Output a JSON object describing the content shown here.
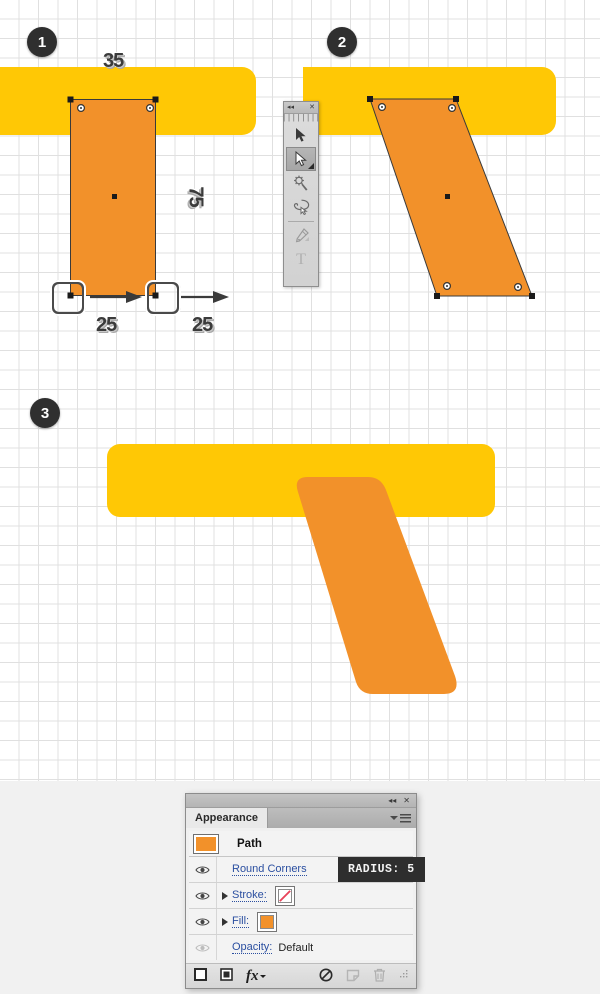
{
  "colors": {
    "yellow": "#ffc805",
    "orange": "#f2912a",
    "badge_bg": "#2f2f2f",
    "tooltip_bg": "#2e2e2e",
    "link_blue": "#2b4fa0",
    "stroke_none_red": "#e8435a"
  },
  "steps": [
    {
      "number": "1"
    },
    {
      "number": "2"
    },
    {
      "number": "3"
    }
  ],
  "dimensions": {
    "width_label": "35",
    "height_label": "75",
    "offset_left_label": "25",
    "offset_right_label": "25"
  },
  "toolbar": {
    "collapse_icon": "◂◂",
    "close_icon": "✕",
    "grip": "||||||||",
    "tools": [
      {
        "name": "selection-tool",
        "glyph": "selection",
        "selected": false
      },
      {
        "name": "direct-selection-tool",
        "glyph": "direct-selection",
        "selected": true
      },
      {
        "name": "magic-wand-tool",
        "glyph": "magic-wand",
        "selected": false
      },
      {
        "name": "lasso-tool",
        "glyph": "lasso",
        "selected": false
      },
      {
        "name": "pen-tool",
        "glyph": "pen",
        "selected": false
      },
      {
        "name": "type-tool",
        "glyph": "T",
        "selected": false
      }
    ]
  },
  "appearance_panel": {
    "collapse_icon": "◂◂",
    "close_icon": "✕",
    "tab_label": "Appearance",
    "rows": [
      {
        "label": "Path",
        "type": "header",
        "swatch": "#f2912a"
      },
      {
        "label": "Round Corners",
        "type": "effect",
        "eye": true,
        "expandable": false
      },
      {
        "label": "Stroke:",
        "type": "stroke",
        "eye": true,
        "expandable": true,
        "swatch": "none"
      },
      {
        "label": "Fill:",
        "type": "fill",
        "eye": true,
        "expandable": true,
        "swatch": "#f2912a"
      },
      {
        "label": "Opacity:",
        "value": "Default",
        "type": "opacity",
        "eye": true,
        "dimmed": true,
        "expandable": false
      }
    ],
    "footer_buttons": [
      {
        "name": "add-new-stroke-button",
        "glyph": "square-outline"
      },
      {
        "name": "add-new-fill-button",
        "glyph": "square-filled"
      },
      {
        "name": "add-new-effect-button",
        "glyph": "fx"
      },
      {
        "name": "clear-appearance-button",
        "glyph": "no-sign"
      },
      {
        "name": "duplicate-item-button",
        "glyph": "duplicate"
      },
      {
        "name": "delete-item-button",
        "glyph": "trash"
      },
      {
        "name": "resize-grip",
        "glyph": "grip"
      }
    ]
  },
  "tooltip": {
    "text": "RADIUS: 5"
  }
}
